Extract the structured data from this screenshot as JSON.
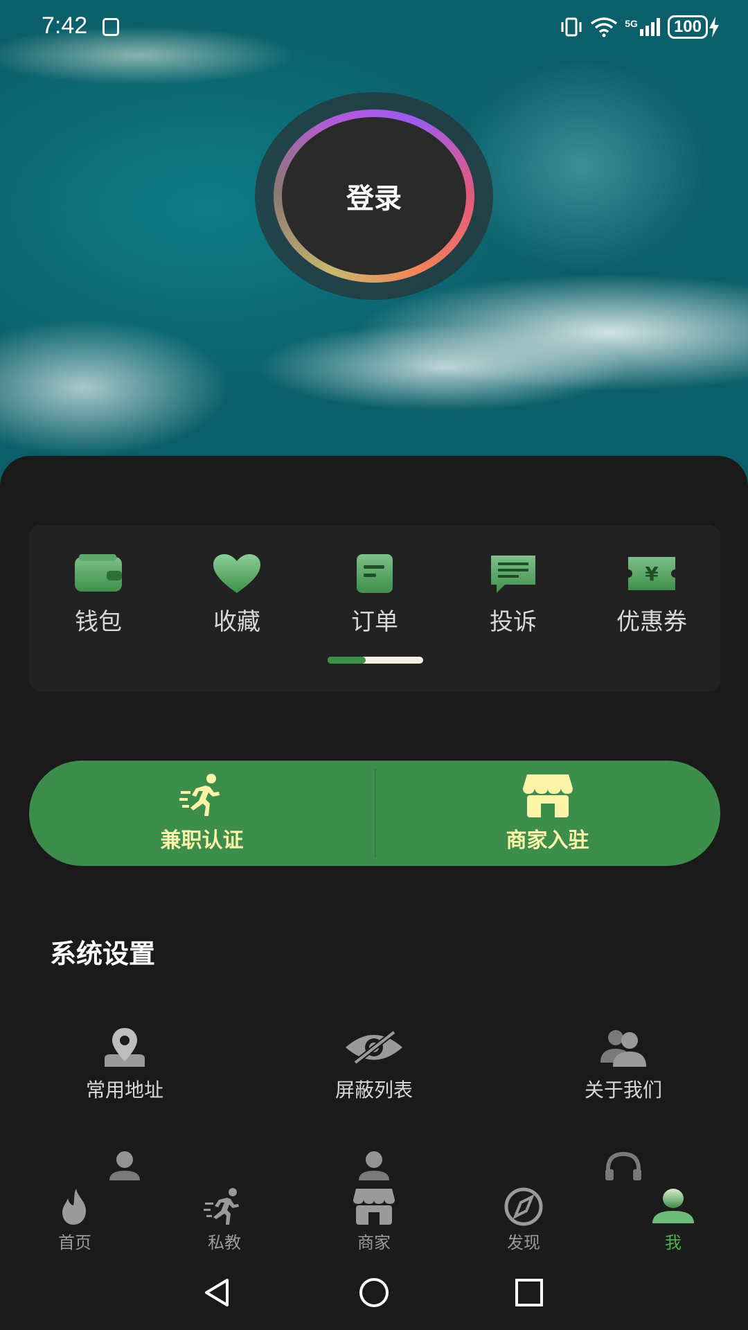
{
  "status_bar": {
    "time": "7:42",
    "network": "5G",
    "battery": "100"
  },
  "login": {
    "label": "登录"
  },
  "quick_actions": [
    {
      "label": "钱包",
      "icon": "wallet-icon"
    },
    {
      "label": "收藏",
      "icon": "heart-icon"
    },
    {
      "label": "订单",
      "icon": "order-icon"
    },
    {
      "label": "投诉",
      "icon": "complaint-icon"
    },
    {
      "label": "优惠券",
      "icon": "coupon-icon"
    }
  ],
  "quick_scroll_progress": 0.4,
  "promo": {
    "left_label": "兼职认证",
    "right_label": "商家入驻"
  },
  "settings": {
    "title": "系统设置",
    "items": [
      {
        "label": "常用地址",
        "icon": "location-icon"
      },
      {
        "label": "屏蔽列表",
        "icon": "eye-off-icon"
      },
      {
        "label": "关于我们",
        "icon": "users-icon"
      }
    ]
  },
  "tabs": [
    {
      "label": "首页",
      "icon": "fire-icon"
    },
    {
      "label": "私教",
      "icon": "runner-icon"
    },
    {
      "label": "商家",
      "icon": "store-icon"
    },
    {
      "label": "发现",
      "icon": "compass-icon"
    },
    {
      "label": "我",
      "icon": "profile-icon",
      "active": true
    }
  ],
  "colors": {
    "accent": "#3d8d4c",
    "promo_text": "#fbf3a8",
    "active_tab": "#4caf50"
  }
}
